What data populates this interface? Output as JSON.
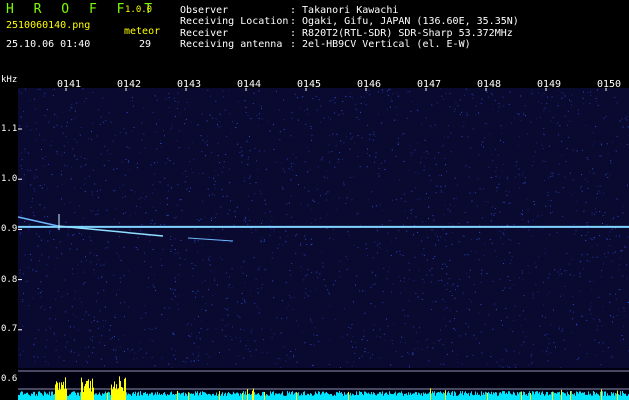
{
  "header": {
    "app_title": "H R O F F T",
    "app_version": "1.0.0",
    "file_name": "2510060140.png",
    "date_time": "25.10.06 01:40",
    "meteor_label": "meteor",
    "meteor_count": "29"
  },
  "info": {
    "observer_label": "Observer",
    "observer_value": ": Takanori Kawachi",
    "location_label": "Receiving Location",
    "location_value": ": Ogaki, Gifu, JAPAN (136.60E, 35.35N)",
    "receiver_label": "Receiver",
    "receiver_value": ": R820T2(RTL-SDR) SDR-Sharp 53.372MHz",
    "antenna_label": "Receiving antenna",
    "antenna_value": ": 2el-HB9CV Vertical (el. E-W)"
  },
  "spectrogram": {
    "y_unit": "kHz",
    "time_ticks": [
      "0141",
      "0142",
      "0143",
      "0144",
      "0145",
      "0146",
      "0147",
      "0148",
      "0149",
      "0150"
    ],
    "freq_ticks": [
      "1.1",
      "1.0",
      "0.9",
      "0.8",
      "0.7",
      "0.6"
    ],
    "freq_tick_values": [
      1.1,
      1.0,
      0.9,
      0.8,
      0.7,
      0.6
    ],
    "carrier_khz": 0.905
  },
  "colors": {
    "background": "#000000",
    "header_yellow": "#ffff00",
    "header_white": "#ffffff",
    "tick_green": "#7cfc00",
    "spectrum_bg": "#0a0a30",
    "carrier": "#7fd4ff",
    "band_cyan": "#00e5ff",
    "band_yellow": "#ffff00"
  }
}
